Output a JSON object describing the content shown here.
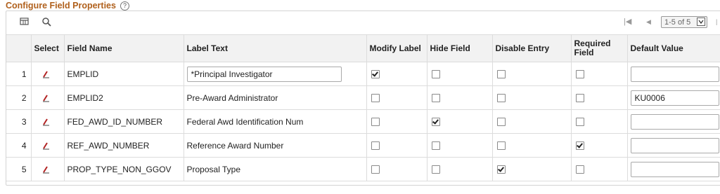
{
  "title": "Configure Field Properties",
  "toolbar": {
    "pager_text": "1-5 of 5"
  },
  "columns": [
    "",
    "Select",
    "Field Name",
    "Label Text",
    "Modify Label",
    "Hide Field",
    "Disable Entry",
    "Required Field",
    "Default Value"
  ],
  "rows": [
    {
      "num": "1",
      "field": "EMPLID",
      "label": "*Principal Investigator",
      "label_editable": true,
      "modify": true,
      "hide": false,
      "disable": false,
      "required": false,
      "default": ""
    },
    {
      "num": "2",
      "field": "EMPLID2",
      "label": "Pre-Award Administrator",
      "label_editable": false,
      "modify": false,
      "hide": false,
      "disable": false,
      "required": false,
      "default": "KU0006"
    },
    {
      "num": "3",
      "field": "FED_AWD_ID_NUMBER",
      "label": "Federal Awd Identification Num",
      "label_editable": false,
      "modify": false,
      "hide": true,
      "disable": false,
      "required": false,
      "default": ""
    },
    {
      "num": "4",
      "field": "REF_AWD_NUMBER",
      "label": "Reference Award Number",
      "label_editable": false,
      "modify": false,
      "hide": false,
      "disable": false,
      "required": true,
      "default": ""
    },
    {
      "num": "5",
      "field": "PROP_TYPE_NON_GGOV",
      "label": "Proposal Type",
      "label_editable": false,
      "modify": false,
      "hide": false,
      "disable": true,
      "required": false,
      "default": ""
    }
  ]
}
